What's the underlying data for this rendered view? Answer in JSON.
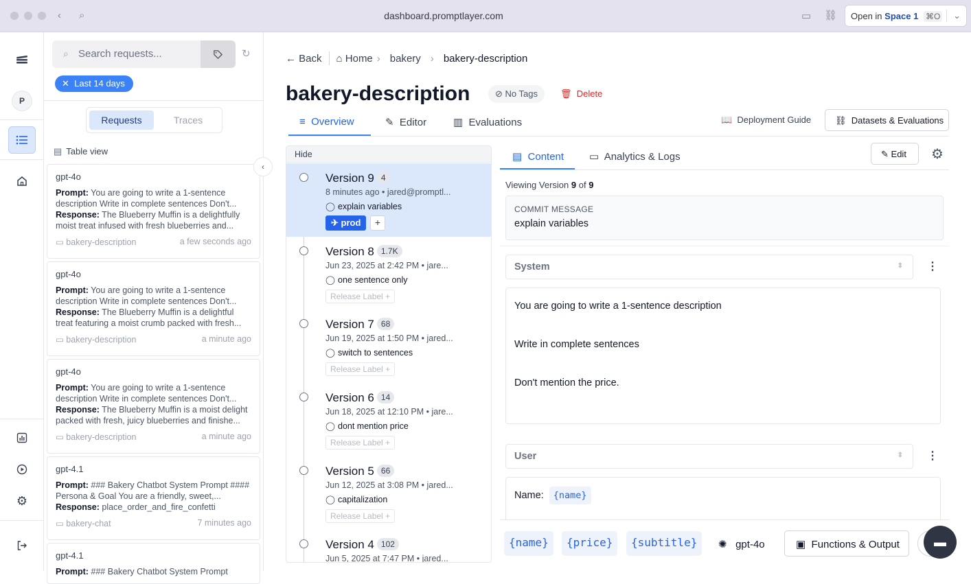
{
  "browser": {
    "url": "dashboard.promptlayer.com",
    "open_in_prefix": "Open in",
    "open_in_space": "Space 1",
    "open_in_shortcut": "⌘O"
  },
  "rail": {
    "avatar_letter": "P"
  },
  "left": {
    "search_placeholder": "Search requests...",
    "date_chip": "Last 14 days",
    "tabs": [
      "Requests",
      "Traces"
    ],
    "table_view": "Table view",
    "cards": [
      {
        "model": "gpt-4o",
        "prompt": "You are going to write a 1-sentence description Write in complete sentences Don't...",
        "response": "The Blueberry Muffin is a delightfully moist treat infused with fresh blueberries and...",
        "folder": "bakery-description",
        "time": "a few seconds ago"
      },
      {
        "model": "gpt-4o",
        "prompt": "You are going to write a 1-sentence description Write in complete sentences Don't...",
        "response": "The Blueberry Muffin is a delightful treat featuring a moist crumb packed with fresh...",
        "folder": "bakery-description",
        "time": "a minute ago"
      },
      {
        "model": "gpt-4o",
        "prompt": "You are going to write a 1-sentence description Write in complete sentences Don't...",
        "response": "The Blueberry Muffin is a moist delight packed with fresh, juicy blueberries and finishe...",
        "folder": "bakery-description",
        "time": "a minute ago"
      },
      {
        "model": "gpt-4.1",
        "prompt": "### Bakery Chatbot System Prompt #### Persona & Goal You are a friendly, sweet,...",
        "response": "place_order_and_fire_confetti",
        "folder": "bakery-chat",
        "time": "7 minutes ago"
      },
      {
        "model": "gpt-4.1",
        "prompt": "### Bakery Chatbot System Prompt",
        "response": "",
        "folder": "",
        "time": ""
      }
    ],
    "prompt_label": "Prompt:",
    "response_label": "Response:"
  },
  "header": {
    "back": "Back",
    "home": "Home",
    "crumb1": "bakery",
    "crumb2": "bakery-description",
    "title": "bakery-description",
    "no_tags": "No Tags",
    "delete": "Delete",
    "tabs": [
      "Overview",
      "Editor",
      "Evaluations"
    ],
    "deployment_guide": "Deployment Guide",
    "datasets": "Datasets & Evaluations"
  },
  "versions": {
    "hide": "Hide",
    "prod_label": "prod",
    "release_label": "Release Label",
    "items": [
      {
        "title": "Version 9",
        "count": "4",
        "meta": "8 minutes ago • jared@promptl...",
        "msg": "explain variables"
      },
      {
        "title": "Version 8",
        "count": "1.7K",
        "meta": "Jun 23, 2025 at 2:42 PM • jare...",
        "msg": "one sentence only"
      },
      {
        "title": "Version 7",
        "count": "68",
        "meta": "Jun 19, 2025 at 1:50 PM • jared...",
        "msg": "switch to sentences"
      },
      {
        "title": "Version 6",
        "count": "14",
        "meta": "Jun 18, 2025 at 12:10 PM • jare...",
        "msg": "dont mention price"
      },
      {
        "title": "Version 5",
        "count": "66",
        "meta": "Jun 12, 2025 at 3:08 PM • jared...",
        "msg": "capitalization"
      },
      {
        "title": "Version 4",
        "count": "102",
        "meta": "Jun 5, 2025 at 7:47 PM • jared...",
        "msg": ""
      }
    ]
  },
  "content": {
    "tabs": [
      "Content",
      "Analytics & Logs"
    ],
    "edit": "Edit",
    "viewing_prefix": "Viewing Version",
    "viewing_version": "9",
    "viewing_of": "of",
    "viewing_total": "9",
    "commit_label": "COMMIT MESSAGE",
    "commit_message": "explain variables",
    "system_role": "System",
    "system_lines": [
      "You are going to write a 1-sentence description",
      "Write in complete sentences",
      "Don't mention the price."
    ],
    "user_role": "User",
    "user_name_label": "Name:",
    "user_var": "{name}",
    "bottom_vars": [
      "{name}",
      "{price}",
      "{subtitle}"
    ],
    "model": "gpt-4o",
    "functions": "Functions & Output"
  }
}
